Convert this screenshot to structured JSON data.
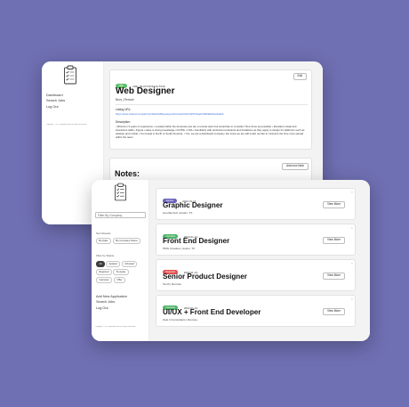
{
  "back_window": {
    "sidebar": {
      "nav": [
        "Dashboard",
        "Search Jobs",
        "Log Out"
      ],
      "copyright": "Copyright © 2021 RightNow.com. All Rights Reserved."
    },
    "detail": {
      "badge": "Offer",
      "badge_color": "#5cbf6a",
      "timestamp": "2021-09-07T16:57:44.572Z",
      "edit_label": "Edit",
      "title": "Web Designer",
      "subtitle": "Bevy | Remote",
      "listing_label": "Listing URL:",
      "listing_url": "https://www.indeed.com/jobs?q=Web%20Developer&l=Austin%2C%20TX&vjk=8bf0fd220a11a9e5",
      "description_label": "Description:",
      "description": "• Minimum 3 years of experience • Located within the Americas (we are a remote team but would like to constrain Time Zone as possible) • Excellent visual and interaction skills • Figma • Have a strong knowledge of HTML / CSS • Familiarity with technical constraints and limitations as they apply to design for platforms such as desktop and mobile • You reside in North or South America. • Yes, we are a distributed company, but since we are still small, we like to minimize the time zone spread within the team."
    },
    "notes": {
      "add_label": "Add new Note",
      "heading": "Notes:"
    }
  },
  "front_window": {
    "sidebar": {
      "filter_placeholder": "Filter By Company",
      "sort_label": "Sort Results",
      "sort_buttons": [
        "By Date",
        "By Company Name"
      ],
      "status_label": "Filter by Status",
      "status_buttons": [
        "All",
        "Applied",
        "Ghosted",
        "Rejected",
        "To-Apply",
        "Interview",
        "Offer"
      ],
      "nav": [
        "Add New Application",
        "Search Jobs",
        "Log Out"
      ],
      "copyright": "Copyright © 2021 RightNow.com. All Rights Reserved."
    },
    "jobs": [
      {
        "status": "Applied",
        "status_color": "#6a62b8",
        "date": "2022-01-14",
        "title": "Graphic Designer",
        "company": "Guerilla Suit | Austin, TX",
        "button": "View More",
        "close": "×"
      },
      {
        "status": "Interview",
        "status_color": "#4fb469",
        "date": "2022-01-14",
        "title": "Front End Designer",
        "company": "HMG Creative | Austin, TX",
        "button": "View More",
        "close": "×"
      },
      {
        "status": "Rejected",
        "status_color": "#e45050",
        "date": "2022-01-13",
        "title": "Senior Product Designer",
        "company": "Tenth | Remote",
        "button": "View More",
        "close": "×"
      },
      {
        "status": "Interview",
        "status_color": "#4fb469",
        "date": "2022-01-13",
        "title": "UI/UX + Front End Developer",
        "company": "Zeal it Consultants | Remote",
        "button": "View More",
        "close": "×"
      }
    ]
  },
  "icons": {
    "logo": "clipboard-checklist-icon",
    "close": "close-icon"
  }
}
